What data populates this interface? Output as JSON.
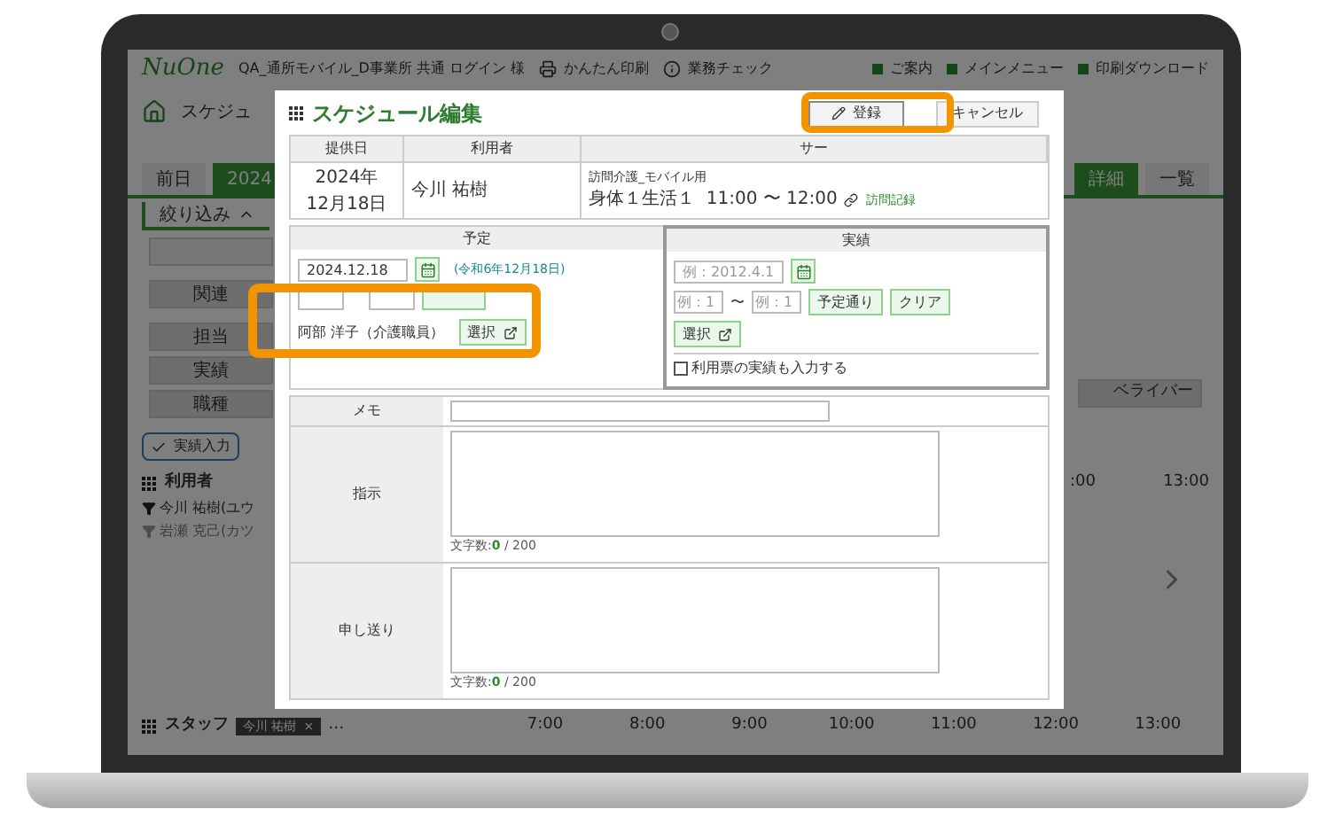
{
  "header": {
    "logo": "NuOne",
    "account": "QA_通所モバイル_D事業所 共通 ログイン 様",
    "links": [
      "かんたん印刷",
      "業務チェック"
    ],
    "menus": [
      "ご案内",
      "メインメニュー",
      "印刷ダウンロード"
    ]
  },
  "breadcrumb": "スケジュ",
  "tabs": [
    {
      "label": "前日",
      "selected": false
    },
    {
      "label": "2024",
      "selected": true
    }
  ],
  "view_tabs": [
    {
      "label": "詳細",
      "selected": true
    },
    {
      "label": "一覧",
      "selected": false
    }
  ],
  "filter": "絞り込み",
  "filter_labels": [
    "関連",
    "担当",
    "実績",
    "職種"
  ],
  "right_field": "ベライバー",
  "actions": [
    "実績入力"
  ],
  "users_heading": "利用者",
  "users": [
    {
      "name": "今川 祐樹(ユウ",
      "active": true
    },
    {
      "name": "岩瀬 克己(カツ",
      "active": false
    }
  ],
  "timeline_top": [
    ":00",
    "13:00"
  ],
  "staff": {
    "heading": "スタッフ",
    "chip": "今川 祐樹",
    "chip_close": "×",
    "more": "…",
    "times": [
      "7:00",
      "8:00",
      "9:00",
      "10:00",
      "11:00",
      "12:00",
      "13:00"
    ]
  },
  "dialog": {
    "title": "スケジュール編集",
    "buttons": [
      "登録",
      "キャンセル"
    ],
    "columns": [
      "提供日",
      "利用者",
      "サー"
    ],
    "row": {
      "date_year": "2024年",
      "date_day": "12月18日",
      "user": "今川 祐樹",
      "service": "訪問介護_モバイル用",
      "detail": "身体１生活１  11:00 〜 12:00",
      "link": "訪問記録"
    },
    "plan": {
      "heading": "予定",
      "date": "2024.12.18",
      "era": "(令和6年12月18日)",
      "staff": "阿部 洋子（介護職員）",
      "select": "選択"
    },
    "actual": {
      "heading": "実績",
      "date_placeholder": "例：2012.4.1",
      "from_placeholder": "例：1",
      "to_placeholder": "例：1",
      "tilde": "〜",
      "buttons": [
        "予定通り",
        "クリア"
      ],
      "select": "選択",
      "checkbox": {
        "label": "利用票の実績も入力する",
        "checked": false
      }
    },
    "memo": "メモ",
    "notes": [
      {
        "label": "指示",
        "counter_label": "文字数:",
        "count": "0",
        "max": " / 200"
      },
      {
        "label": "申し送り",
        "counter_label": "文字数:",
        "count": "0",
        "max": " / 200"
      }
    ]
  }
}
